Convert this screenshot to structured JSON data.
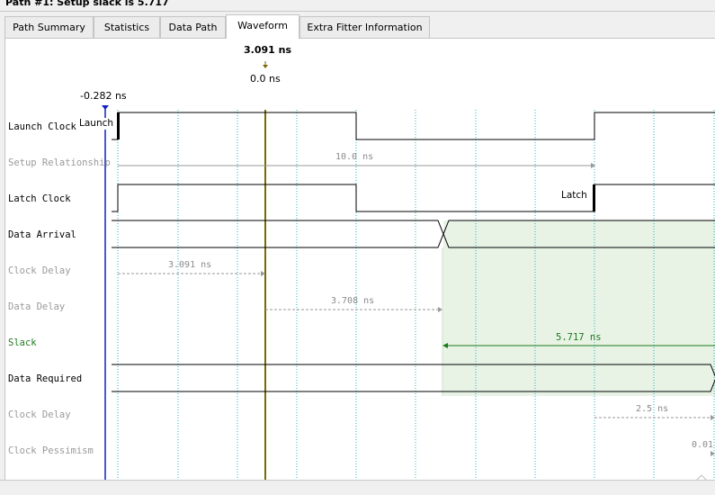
{
  "window": {
    "title": "Path #1: Setup slack is 5.717"
  },
  "tabs": [
    {
      "label": "Path Summary",
      "active": false
    },
    {
      "label": "Statistics",
      "active": false
    },
    {
      "label": "Data Path",
      "active": false
    },
    {
      "label": "Waveform",
      "active": true
    },
    {
      "label": "Extra Fitter Information",
      "active": false
    }
  ],
  "markers": {
    "cursor_time": "3.091 ns",
    "cursor_delta": "0.0 ns",
    "origin_time": "-0.282 ns"
  },
  "rows": {
    "launch_clock": "Launch Clock",
    "setup_relationship": "Setup Relationship",
    "latch_clock": "Latch Clock",
    "data_arrival": "Data Arrival",
    "clock_delay": "Clock Delay",
    "data_delay": "Data Delay",
    "slack": "Slack",
    "data_required": "Data Required",
    "clock_delay_2": "Clock Delay",
    "clock_pessimism": "Clock Pessimism"
  },
  "annotations": {
    "launch_edge": "Launch",
    "latch_edge": "Latch",
    "setup_relationship_value": "10.0 ns",
    "clock_delay_value": "3.091 ns",
    "data_delay_value": "3.708 ns",
    "slack_value": "5.717 ns",
    "clock_delay_2_value": "2.5 ns",
    "clock_pessimism_value": "0.01"
  },
  "colors": {
    "cursor_line": "#7a6a00",
    "origin_line": "#1020c0",
    "grid_dotted": "#18b4c8",
    "slack_arrow": "#1a7a1a",
    "slack_region": "#e8f3e6",
    "dim_arrow": "#9a9a9a"
  }
}
